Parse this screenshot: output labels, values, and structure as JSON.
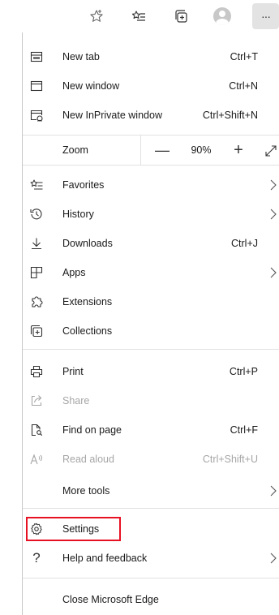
{
  "toolbar": {
    "icons": [
      "favorite-star-icon",
      "favorites-list-icon",
      "collections-icon",
      "profile-avatar",
      "settings-and-more-icon"
    ],
    "more_label": "···"
  },
  "menu": {
    "new_tab": {
      "label": "New tab",
      "shortcut": "Ctrl+T"
    },
    "new_window": {
      "label": "New window",
      "shortcut": "Ctrl+N"
    },
    "new_inprivate": {
      "label": "New InPrivate window",
      "shortcut": "Ctrl+Shift+N"
    },
    "zoom": {
      "label": "Zoom",
      "minus": "—",
      "value": "90%",
      "plus": "+"
    },
    "favorites": {
      "label": "Favorites"
    },
    "history": {
      "label": "History"
    },
    "downloads": {
      "label": "Downloads",
      "shortcut": "Ctrl+J"
    },
    "apps": {
      "label": "Apps"
    },
    "extensions": {
      "label": "Extensions"
    },
    "collections": {
      "label": "Collections"
    },
    "print": {
      "label": "Print",
      "shortcut": "Ctrl+P"
    },
    "share": {
      "label": "Share"
    },
    "find": {
      "label": "Find on page",
      "shortcut": "Ctrl+F"
    },
    "read_aloud": {
      "label": "Read aloud",
      "shortcut": "Ctrl+Shift+U"
    },
    "more_tools": {
      "label": "More tools"
    },
    "settings": {
      "label": "Settings"
    },
    "help": {
      "label": "Help and feedback"
    },
    "close": {
      "label": "Close Microsoft Edge"
    }
  },
  "colors": {
    "highlight": "#e81123",
    "disabled_text": "#a6a6a6",
    "active_button_bg": "#e3e3e3"
  }
}
